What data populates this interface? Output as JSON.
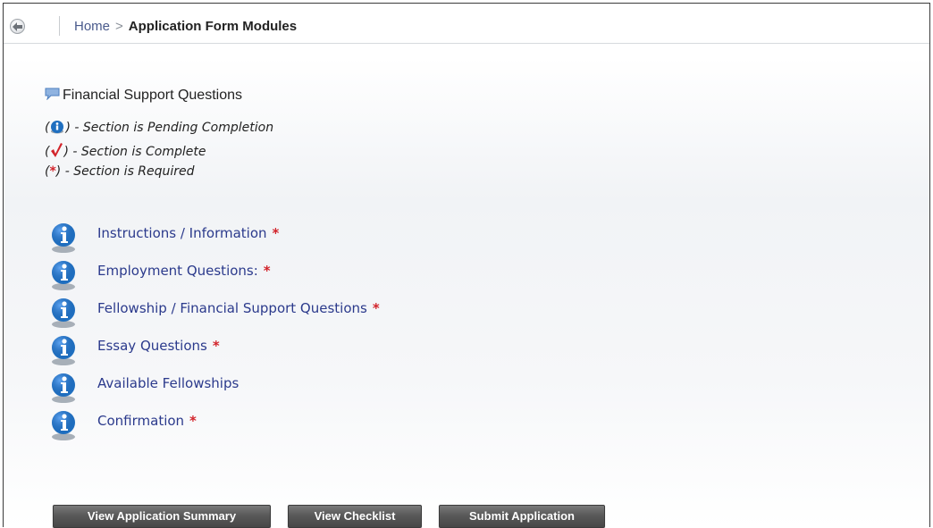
{
  "breadcrumb": {
    "home": "Home",
    "separator": ">",
    "current": "Application Form Modules"
  },
  "section": {
    "title": "Financial Support Questions",
    "icon": "chat-bubble-icon"
  },
  "legend": {
    "pending": {
      "open": "(",
      "close": ") - Section is Pending Completion"
    },
    "complete": {
      "open": "(",
      "close": ") - Section is Complete"
    },
    "required": {
      "open": "(",
      "star": "*",
      "close": ") - Section is Required"
    }
  },
  "modules": [
    {
      "label": "Instructions / Information",
      "required": true
    },
    {
      "label": "Employment Questions:",
      "required": true
    },
    {
      "label": "Fellowship / Financial Support Questions",
      "required": true
    },
    {
      "label": "Essay Questions",
      "required": true
    },
    {
      "label": "Available Fellowships",
      "required": false
    },
    {
      "label": "Confirmation",
      "required": true
    }
  ],
  "required_marker": "*",
  "buttons": {
    "summary": "View Application Summary",
    "checklist": "View Checklist",
    "submit": "Submit Application"
  },
  "colors": {
    "link": "#2b3a8c",
    "required": "#d2232a",
    "info_icon": "#1f6fc0",
    "button": "#555555"
  }
}
